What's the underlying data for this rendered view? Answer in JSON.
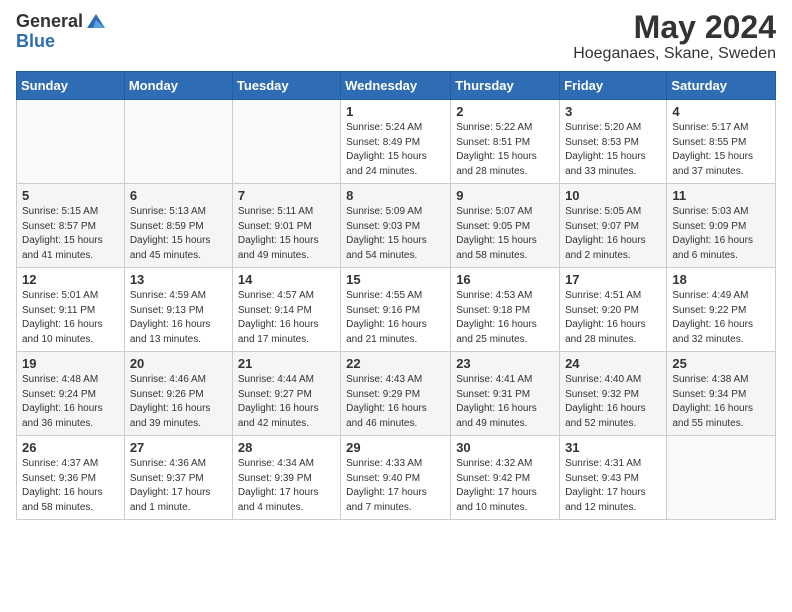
{
  "header": {
    "logo_general": "General",
    "logo_blue": "Blue",
    "month_title": "May 2024",
    "location": "Hoeganaes, Skane, Sweden"
  },
  "days_of_week": [
    "Sunday",
    "Monday",
    "Tuesday",
    "Wednesday",
    "Thursday",
    "Friday",
    "Saturday"
  ],
  "weeks": [
    [
      {
        "day": "",
        "info": ""
      },
      {
        "day": "",
        "info": ""
      },
      {
        "day": "",
        "info": ""
      },
      {
        "day": "1",
        "info": "Sunrise: 5:24 AM\nSunset: 8:49 PM\nDaylight: 15 hours\nand 24 minutes."
      },
      {
        "day": "2",
        "info": "Sunrise: 5:22 AM\nSunset: 8:51 PM\nDaylight: 15 hours\nand 28 minutes."
      },
      {
        "day": "3",
        "info": "Sunrise: 5:20 AM\nSunset: 8:53 PM\nDaylight: 15 hours\nand 33 minutes."
      },
      {
        "day": "4",
        "info": "Sunrise: 5:17 AM\nSunset: 8:55 PM\nDaylight: 15 hours\nand 37 minutes."
      }
    ],
    [
      {
        "day": "5",
        "info": "Sunrise: 5:15 AM\nSunset: 8:57 PM\nDaylight: 15 hours\nand 41 minutes."
      },
      {
        "day": "6",
        "info": "Sunrise: 5:13 AM\nSunset: 8:59 PM\nDaylight: 15 hours\nand 45 minutes."
      },
      {
        "day": "7",
        "info": "Sunrise: 5:11 AM\nSunset: 9:01 PM\nDaylight: 15 hours\nand 49 minutes."
      },
      {
        "day": "8",
        "info": "Sunrise: 5:09 AM\nSunset: 9:03 PM\nDaylight: 15 hours\nand 54 minutes."
      },
      {
        "day": "9",
        "info": "Sunrise: 5:07 AM\nSunset: 9:05 PM\nDaylight: 15 hours\nand 58 minutes."
      },
      {
        "day": "10",
        "info": "Sunrise: 5:05 AM\nSunset: 9:07 PM\nDaylight: 16 hours\nand 2 minutes."
      },
      {
        "day": "11",
        "info": "Sunrise: 5:03 AM\nSunset: 9:09 PM\nDaylight: 16 hours\nand 6 minutes."
      }
    ],
    [
      {
        "day": "12",
        "info": "Sunrise: 5:01 AM\nSunset: 9:11 PM\nDaylight: 16 hours\nand 10 minutes."
      },
      {
        "day": "13",
        "info": "Sunrise: 4:59 AM\nSunset: 9:13 PM\nDaylight: 16 hours\nand 13 minutes."
      },
      {
        "day": "14",
        "info": "Sunrise: 4:57 AM\nSunset: 9:14 PM\nDaylight: 16 hours\nand 17 minutes."
      },
      {
        "day": "15",
        "info": "Sunrise: 4:55 AM\nSunset: 9:16 PM\nDaylight: 16 hours\nand 21 minutes."
      },
      {
        "day": "16",
        "info": "Sunrise: 4:53 AM\nSunset: 9:18 PM\nDaylight: 16 hours\nand 25 minutes."
      },
      {
        "day": "17",
        "info": "Sunrise: 4:51 AM\nSunset: 9:20 PM\nDaylight: 16 hours\nand 28 minutes."
      },
      {
        "day": "18",
        "info": "Sunrise: 4:49 AM\nSunset: 9:22 PM\nDaylight: 16 hours\nand 32 minutes."
      }
    ],
    [
      {
        "day": "19",
        "info": "Sunrise: 4:48 AM\nSunset: 9:24 PM\nDaylight: 16 hours\nand 36 minutes."
      },
      {
        "day": "20",
        "info": "Sunrise: 4:46 AM\nSunset: 9:26 PM\nDaylight: 16 hours\nand 39 minutes."
      },
      {
        "day": "21",
        "info": "Sunrise: 4:44 AM\nSunset: 9:27 PM\nDaylight: 16 hours\nand 42 minutes."
      },
      {
        "day": "22",
        "info": "Sunrise: 4:43 AM\nSunset: 9:29 PM\nDaylight: 16 hours\nand 46 minutes."
      },
      {
        "day": "23",
        "info": "Sunrise: 4:41 AM\nSunset: 9:31 PM\nDaylight: 16 hours\nand 49 minutes."
      },
      {
        "day": "24",
        "info": "Sunrise: 4:40 AM\nSunset: 9:32 PM\nDaylight: 16 hours\nand 52 minutes."
      },
      {
        "day": "25",
        "info": "Sunrise: 4:38 AM\nSunset: 9:34 PM\nDaylight: 16 hours\nand 55 minutes."
      }
    ],
    [
      {
        "day": "26",
        "info": "Sunrise: 4:37 AM\nSunset: 9:36 PM\nDaylight: 16 hours\nand 58 minutes."
      },
      {
        "day": "27",
        "info": "Sunrise: 4:36 AM\nSunset: 9:37 PM\nDaylight: 17 hours\nand 1 minute."
      },
      {
        "day": "28",
        "info": "Sunrise: 4:34 AM\nSunset: 9:39 PM\nDaylight: 17 hours\nand 4 minutes."
      },
      {
        "day": "29",
        "info": "Sunrise: 4:33 AM\nSunset: 9:40 PM\nDaylight: 17 hours\nand 7 minutes."
      },
      {
        "day": "30",
        "info": "Sunrise: 4:32 AM\nSunset: 9:42 PM\nDaylight: 17 hours\nand 10 minutes."
      },
      {
        "day": "31",
        "info": "Sunrise: 4:31 AM\nSunset: 9:43 PM\nDaylight: 17 hours\nand 12 minutes."
      },
      {
        "day": "",
        "info": ""
      }
    ]
  ]
}
